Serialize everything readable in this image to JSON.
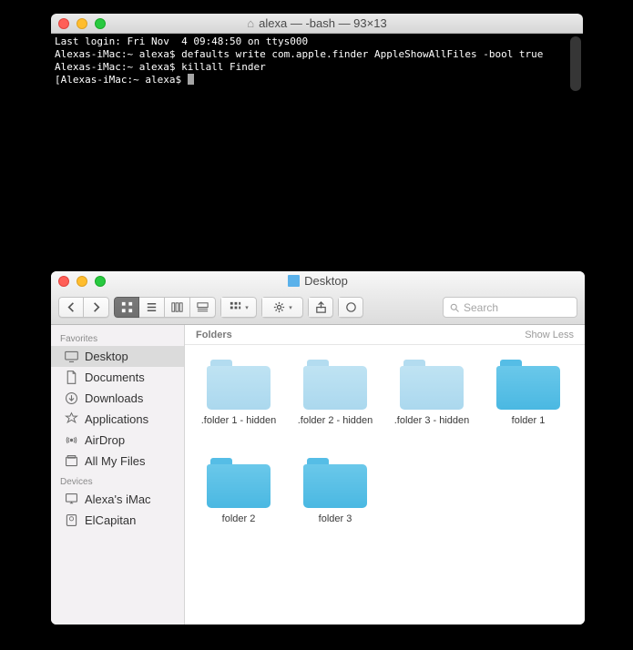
{
  "terminal": {
    "title": "alexa — -bash — 93×13",
    "lines": [
      "Last login: Fri Nov  4 09:48:50 on ttys000",
      "Alexas-iMac:~ alexa$ defaults write com.apple.finder AppleShowAllFiles -bool true",
      "Alexas-iMac:~ alexa$ killall Finder",
      "[Alexas-iMac:~ alexa$ "
    ]
  },
  "finder": {
    "title": "Desktop",
    "search_placeholder": "Search",
    "section_label": "Folders",
    "show_less_label": "Show Less",
    "sidebar": {
      "favorites_label": "Favorites",
      "devices_label": "Devices",
      "favorites": [
        {
          "label": "Desktop",
          "icon": "desktop",
          "selected": true
        },
        {
          "label": "Documents",
          "icon": "documents",
          "selected": false
        },
        {
          "label": "Downloads",
          "icon": "downloads",
          "selected": false
        },
        {
          "label": "Applications",
          "icon": "applications",
          "selected": false
        },
        {
          "label": "AirDrop",
          "icon": "airdrop",
          "selected": false
        },
        {
          "label": "All My Files",
          "icon": "allfiles",
          "selected": false
        }
      ],
      "devices": [
        {
          "label": "Alexa's iMac",
          "icon": "imac"
        },
        {
          "label": "ElCapitan",
          "icon": "disk"
        }
      ]
    },
    "items": [
      {
        "label": ".folder 1 - hidden",
        "hidden": true
      },
      {
        "label": ".folder 2 - hidden",
        "hidden": true
      },
      {
        "label": ".folder 3 - hidden",
        "hidden": true
      },
      {
        "label": "folder 1",
        "hidden": false
      },
      {
        "label": "folder 2",
        "hidden": false
      },
      {
        "label": "folder 3",
        "hidden": false
      }
    ]
  }
}
